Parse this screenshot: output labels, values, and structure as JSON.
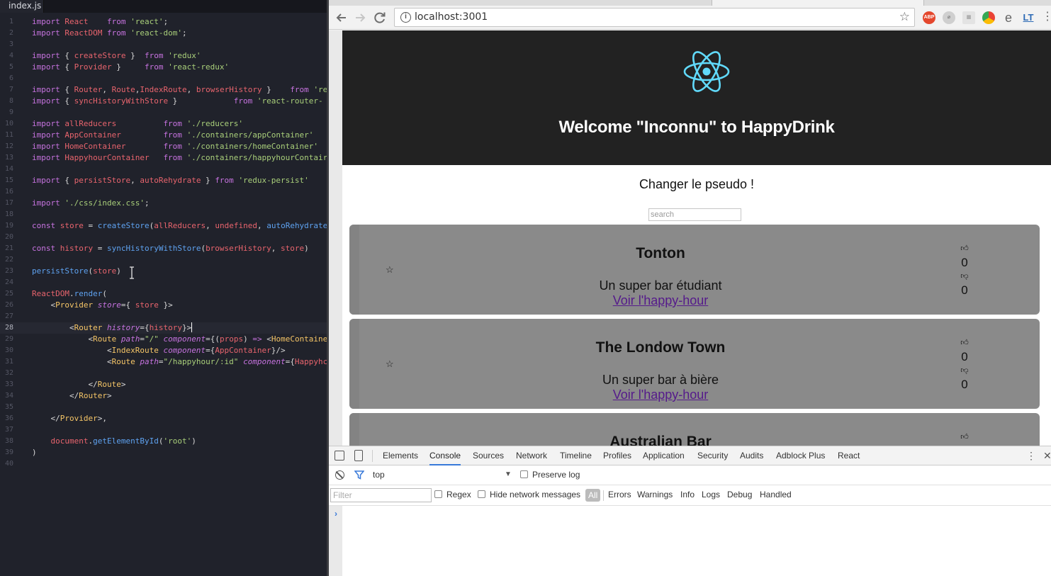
{
  "editor": {
    "tab_label": "index.js",
    "lines": [
      [
        [
          "kw",
          "import "
        ],
        [
          "vr",
          "React    "
        ],
        [
          "kw",
          "from "
        ],
        [
          "st",
          "'react'"
        ],
        [
          "pn",
          ";"
        ]
      ],
      [
        [
          "kw",
          "import "
        ],
        [
          "vr",
          "ReactDOM "
        ],
        [
          "kw",
          "from "
        ],
        [
          "st",
          "'react-dom'"
        ],
        [
          "pn",
          ";"
        ]
      ],
      [],
      [
        [
          "kw",
          "import "
        ],
        [
          "pn",
          "{ "
        ],
        [
          "vr",
          "createStore"
        ],
        [
          "pn",
          " }  "
        ],
        [
          "kw",
          "from "
        ],
        [
          "st",
          "'redux'"
        ]
      ],
      [
        [
          "kw",
          "import "
        ],
        [
          "pn",
          "{ "
        ],
        [
          "vr",
          "Provider"
        ],
        [
          "pn",
          " }     "
        ],
        [
          "kw",
          "from "
        ],
        [
          "st",
          "'react-redux'"
        ]
      ],
      [],
      [
        [
          "kw",
          "import "
        ],
        [
          "pn",
          "{ "
        ],
        [
          "vr",
          "Router"
        ],
        [
          "pn",
          ", "
        ],
        [
          "vr",
          "Route"
        ],
        [
          "pn",
          ","
        ],
        [
          "vr",
          "IndexRoute"
        ],
        [
          "pn",
          ", "
        ],
        [
          "vr",
          "browserHistory"
        ],
        [
          "pn",
          " }    "
        ],
        [
          "kw",
          "from "
        ],
        [
          "st",
          "'re"
        ]
      ],
      [
        [
          "kw",
          "import "
        ],
        [
          "pn",
          "{ "
        ],
        [
          "vr",
          "syncHistoryWithStore"
        ],
        [
          "pn",
          " }            "
        ],
        [
          "kw",
          "from "
        ],
        [
          "st",
          "'react-router-"
        ]
      ],
      [],
      [
        [
          "kw",
          "import "
        ],
        [
          "vr",
          "allReducers          "
        ],
        [
          "kw",
          "from "
        ],
        [
          "st",
          "'./reducers'"
        ]
      ],
      [
        [
          "kw",
          "import "
        ],
        [
          "vr",
          "AppContainer         "
        ],
        [
          "kw",
          "from "
        ],
        [
          "st",
          "'./containers/appContainer'"
        ]
      ],
      [
        [
          "kw",
          "import "
        ],
        [
          "vr",
          "HomeContainer        "
        ],
        [
          "kw",
          "from "
        ],
        [
          "st",
          "'./containers/homeContainer'"
        ]
      ],
      [
        [
          "kw",
          "import "
        ],
        [
          "vr",
          "HappyhourContainer   "
        ],
        [
          "kw",
          "from "
        ],
        [
          "st",
          "'./containers/happyhourContair"
        ]
      ],
      [],
      [
        [
          "kw",
          "import "
        ],
        [
          "pn",
          "{ "
        ],
        [
          "vr",
          "persistStore"
        ],
        [
          "pn",
          ", "
        ],
        [
          "vr",
          "autoRehydrate"
        ],
        [
          "pn",
          " } "
        ],
        [
          "kw",
          "from "
        ],
        [
          "st",
          "'redux-persist'"
        ]
      ],
      [],
      [
        [
          "kw",
          "import "
        ],
        [
          "st",
          "'./css/index.css'"
        ],
        [
          "pn",
          ";"
        ]
      ],
      [],
      [
        [
          "kw",
          "const "
        ],
        [
          "vr",
          "store "
        ],
        [
          "pn",
          "= "
        ],
        [
          "fn",
          "createStore"
        ],
        [
          "pn",
          "("
        ],
        [
          "vr",
          "allReducers"
        ],
        [
          "pn",
          ", "
        ],
        [
          "vr",
          "undefined"
        ],
        [
          "pn",
          ", "
        ],
        [
          "fn",
          "autoRehydrate"
        ]
      ],
      [],
      [
        [
          "kw",
          "const "
        ],
        [
          "vr",
          "history "
        ],
        [
          "pn",
          "= "
        ],
        [
          "fn",
          "syncHistoryWithStore"
        ],
        [
          "pn",
          "("
        ],
        [
          "vr",
          "browserHistory"
        ],
        [
          "pn",
          ", "
        ],
        [
          "vr",
          "store"
        ],
        [
          "pn",
          ")"
        ]
      ],
      [],
      [
        [
          "fn",
          "persistStore"
        ],
        [
          "pn",
          "("
        ],
        [
          "vr",
          "store"
        ],
        [
          "pn",
          ")"
        ]
      ],
      [],
      [
        [
          "vr",
          "ReactDOM"
        ],
        [
          "pn",
          "."
        ],
        [
          "fn",
          "render"
        ],
        [
          "pn",
          "("
        ]
      ],
      [
        [
          "pn",
          "    <"
        ],
        [
          "tg",
          "Provider "
        ],
        [
          "at",
          "store"
        ],
        [
          "pn",
          "={ "
        ],
        [
          "vr",
          "store"
        ],
        [
          "pn",
          " }>"
        ]
      ],
      [],
      [
        [
          "pn",
          "        <"
        ],
        [
          "tg",
          "Router "
        ],
        [
          "at",
          "history"
        ],
        [
          "pn",
          "={"
        ],
        [
          "vr",
          "history"
        ],
        [
          "pn",
          "}>"
        ]
      ],
      [
        [
          "pn",
          "            <"
        ],
        [
          "tg",
          "Route "
        ],
        [
          "at",
          "path"
        ],
        [
          "pn",
          "="
        ],
        [
          "st",
          "\"/\" "
        ],
        [
          "at",
          "component"
        ],
        [
          "pn",
          "={("
        ],
        [
          "vr",
          "props"
        ],
        [
          "pn",
          ") "
        ],
        [
          "kw",
          "=> "
        ],
        [
          "pn",
          "<"
        ],
        [
          "tg",
          "HomeContaine"
        ]
      ],
      [
        [
          "pn",
          "                <"
        ],
        [
          "tg",
          "IndexRoute "
        ],
        [
          "at",
          "component"
        ],
        [
          "pn",
          "={"
        ],
        [
          "vr",
          "AppContainer"
        ],
        [
          "pn",
          "}/>"
        ]
      ],
      [
        [
          "pn",
          "                <"
        ],
        [
          "tg",
          "Route "
        ],
        [
          "at",
          "path"
        ],
        [
          "pn",
          "="
        ],
        [
          "st",
          "\"/happyhour/:id\" "
        ],
        [
          "at",
          "component"
        ],
        [
          "pn",
          "={"
        ],
        [
          "vr",
          "Happyhc"
        ]
      ],
      [],
      [
        [
          "pn",
          "            </"
        ],
        [
          "tg",
          "Route"
        ],
        [
          "pn",
          ">"
        ]
      ],
      [
        [
          "pn",
          "        </"
        ],
        [
          "tg",
          "Router"
        ],
        [
          "pn",
          ">"
        ]
      ],
      [],
      [
        [
          "pn",
          "    </"
        ],
        [
          "tg",
          "Provider"
        ],
        [
          "pn",
          ">,"
        ]
      ],
      [],
      [
        [
          "pn",
          "    "
        ],
        [
          "vr",
          "document"
        ],
        [
          "pn",
          "."
        ],
        [
          "fn",
          "getElementById"
        ],
        [
          "pn",
          "("
        ],
        [
          "st",
          "'root'"
        ],
        [
          "pn",
          ")"
        ]
      ],
      [
        [
          "pn",
          ")"
        ]
      ],
      []
    ]
  },
  "browser": {
    "url": "localhost:3001",
    "extensions": {
      "abp": "ABP",
      "lt": "LT"
    },
    "page": {
      "title": "Welcome \"Inconnu\" to HappyDrink",
      "change_pseudo": "Changer le pseudo !",
      "search_placeholder": "search",
      "bars": [
        {
          "name": "Tonton",
          "description": "Un super bar étudiant",
          "link": "Voir l'happy-hour",
          "likes": "0",
          "dislikes": "0"
        },
        {
          "name": "The Londow Town",
          "description": "Un super bar à bière",
          "link": "Voir l'happy-hour",
          "likes": "0",
          "dislikes": "0"
        },
        {
          "name": "Australian Bar",
          "description": "",
          "link": "",
          "likes": "",
          "dislikes": ""
        }
      ]
    }
  },
  "devtools": {
    "tabs": [
      "Elements",
      "Console",
      "Sources",
      "Network",
      "Timeline",
      "Profiles",
      "Application",
      "Security",
      "Audits",
      "Adblock Plus",
      "React"
    ],
    "active_tab": "Console",
    "context": "top",
    "preserve_log": "Preserve log",
    "filter_placeholder": "Filter",
    "regex": "Regex",
    "hide_network": "Hide network messages",
    "levels": [
      "All",
      "Errors",
      "Warnings",
      "Info",
      "Logs",
      "Debug",
      "Handled"
    ],
    "prompt": "›"
  },
  "colors": {
    "editor_bg": "#20222b",
    "keyword": "#c773e0",
    "variable": "#e8646d",
    "string": "#a9cf7a",
    "function": "#5ea2f0",
    "tag": "#f6c667",
    "app_header_bg": "#222222",
    "react_logo": "#61dafb",
    "card_bg": "#8a8a8a",
    "link_visited": "#551a8b",
    "devtools_accent": "#3879d9"
  }
}
